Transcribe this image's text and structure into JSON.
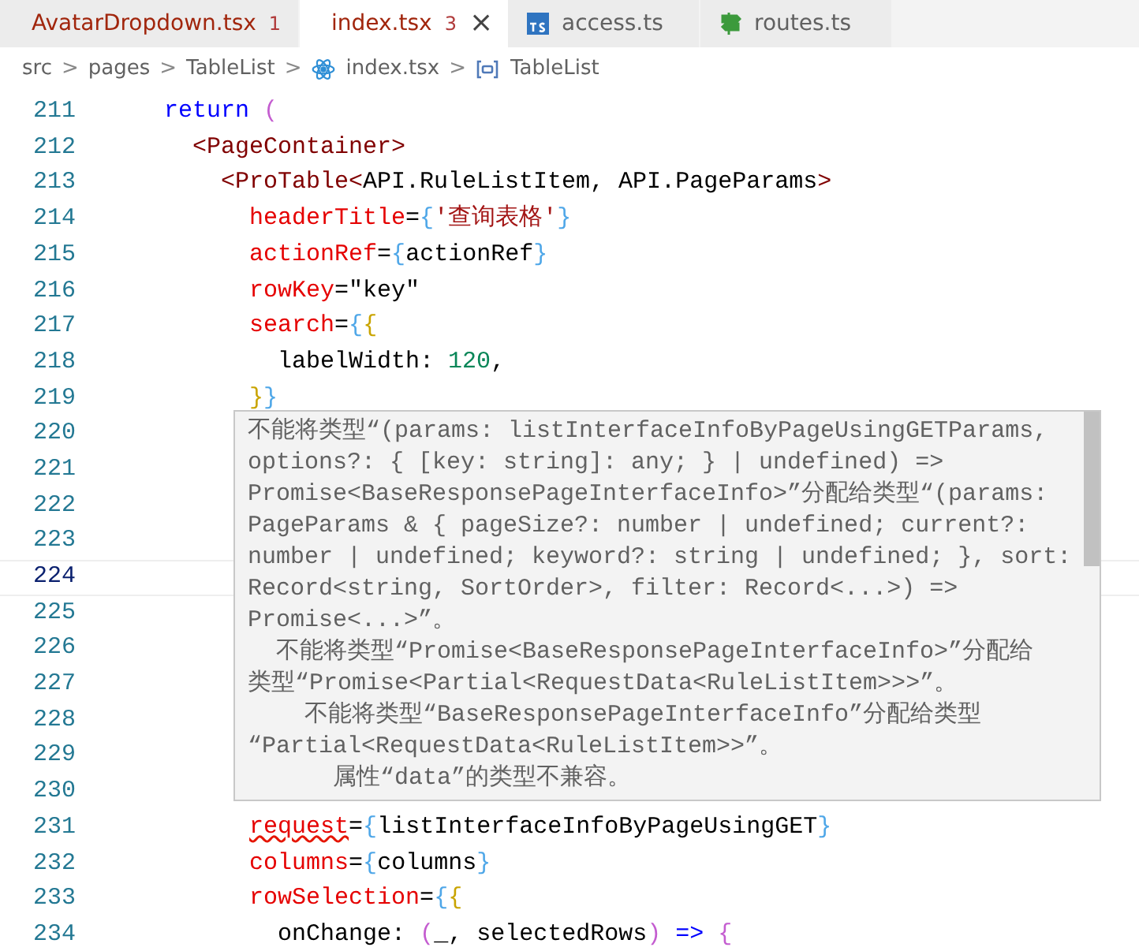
{
  "tabs": [
    {
      "label": "AvatarDropdown.tsx",
      "badge": "1",
      "kind": "react",
      "selected": false,
      "error": true
    },
    {
      "label": "index.tsx",
      "badge": "3",
      "kind": "react",
      "selected": true,
      "error": true,
      "close": "×"
    },
    {
      "label": "access.ts",
      "kind": "ts",
      "selected": false,
      "error": false
    },
    {
      "label": "routes.ts",
      "kind": "route",
      "selected": false,
      "error": false
    }
  ],
  "breadcrumb": [
    {
      "label": "src",
      "kind": "folder"
    },
    {
      "label": "pages",
      "kind": "folder"
    },
    {
      "label": "TableList",
      "kind": "folder"
    },
    {
      "label": "index.tsx",
      "kind": "react"
    },
    {
      "label": "TableList",
      "kind": "symbol"
    }
  ],
  "separator": ">",
  "editor": {
    "lines": [
      {
        "number": "211",
        "current": false,
        "tokens": [
          {
            "kind": "keyword",
            "text": "    return"
          },
          {
            "kind": "bracket3",
            "text": " ("
          }
        ]
      },
      {
        "number": "212",
        "current": false,
        "tokens": [
          {
            "kind": "tag",
            "text": "      <PageContainer>"
          }
        ]
      },
      {
        "number": "213",
        "current": false,
        "tokens": [
          {
            "kind": "tag",
            "text": "        <ProTable<"
          },
          {
            "kind": "plain",
            "text": "API.RuleListItem, API.PageParams"
          },
          {
            "kind": "tag",
            "text": ">"
          }
        ]
      },
      {
        "number": "214",
        "current": false,
        "tokens": [
          {
            "kind": "attr",
            "text": "          headerTitle"
          },
          {
            "kind": "plain",
            "text": "="
          },
          {
            "kind": "bracket1",
            "text": "{"
          },
          {
            "kind": "string",
            "text": "'查询表格'"
          },
          {
            "kind": "bracket1",
            "text": "}"
          }
        ]
      },
      {
        "number": "215",
        "current": false,
        "tokens": [
          {
            "kind": "attr",
            "text": "          actionRef"
          },
          {
            "kind": "plain",
            "text": "="
          },
          {
            "kind": "bracket1",
            "text": "{"
          },
          {
            "kind": "plain",
            "text": "actionRef"
          },
          {
            "kind": "bracket1",
            "text": "}"
          }
        ]
      },
      {
        "number": "216",
        "current": false,
        "tokens": [
          {
            "kind": "attr",
            "text": "          rowKey"
          },
          {
            "kind": "plain",
            "text": "=\"key\""
          }
        ]
      },
      {
        "number": "217",
        "current": false,
        "tokens": [
          {
            "kind": "attr",
            "text": "          search"
          },
          {
            "kind": "plain",
            "text": "="
          },
          {
            "kind": "bracket1",
            "text": "{"
          },
          {
            "kind": "bracket2",
            "text": "{"
          }
        ]
      },
      {
        "number": "218",
        "current": false,
        "tokens": [
          {
            "kind": "plain",
            "text": "            labelWidth: "
          },
          {
            "kind": "number",
            "text": "120"
          },
          {
            "kind": "plain",
            "text": ","
          }
        ]
      },
      {
        "number": "219",
        "current": false,
        "tokens": [
          {
            "kind": "bracket2",
            "text": "          }"
          },
          {
            "kind": "bracket1",
            "text": "}"
          }
        ]
      },
      {
        "number": "220",
        "current": false
      },
      {
        "number": "221",
        "current": false
      },
      {
        "number": "222",
        "current": false
      },
      {
        "number": "223",
        "current": false
      },
      {
        "number": "224",
        "current": true
      },
      {
        "number": "225",
        "current": false
      },
      {
        "number": "226",
        "current": false
      },
      {
        "number": "227",
        "current": false
      },
      {
        "number": "228",
        "current": false
      },
      {
        "number": "229",
        "current": false
      },
      {
        "number": "230",
        "current": false
      },
      {
        "number": "231",
        "current": false,
        "tokens": [
          {
            "kind": "attr",
            "text": "          request",
            "error": true
          },
          {
            "kind": "plain",
            "text": "="
          },
          {
            "kind": "bracket1",
            "text": "{"
          },
          {
            "kind": "plain",
            "text": "listInterfaceInfoByPageUsingGET"
          },
          {
            "kind": "bracket1",
            "text": "}"
          }
        ]
      },
      {
        "number": "232",
        "current": false,
        "tokens": [
          {
            "kind": "attr",
            "text": "          columns"
          },
          {
            "kind": "plain",
            "text": "="
          },
          {
            "kind": "bracket1",
            "text": "{"
          },
          {
            "kind": "plain",
            "text": "columns"
          },
          {
            "kind": "bracket1",
            "text": "}"
          }
        ]
      },
      {
        "number": "233",
        "current": false,
        "tokens": [
          {
            "kind": "attr",
            "text": "          rowSelection"
          },
          {
            "kind": "plain",
            "text": "="
          },
          {
            "kind": "bracket1",
            "text": "{"
          },
          {
            "kind": "bracket2",
            "text": "{"
          }
        ]
      },
      {
        "number": "234",
        "current": false,
        "tokens": [
          {
            "kind": "plain",
            "text": "            onChange: "
          },
          {
            "kind": "bracket3",
            "text": "("
          },
          {
            "kind": "plain",
            "text": "_, selectedRows"
          },
          {
            "kind": "bracket3",
            "text": ")"
          },
          {
            "kind": "keyword",
            "text": " =>"
          },
          {
            "kind": "bracket3",
            "text": " {"
          }
        ]
      }
    ]
  },
  "hover": {
    "lines": [
      "不能将类型“(params: listInterfaceInfoByPageUsingGETParams,",
      "options?: { [key: string]: any; } | undefined) =>",
      "Promise<BaseResponsePageInterfaceInfo>”分配给类型“(params:",
      "PageParams & { pageSize?: number | undefined; current?:",
      "number | undefined; keyword?: string | undefined; }, sort:",
      "Record<string, SortOrder>, filter: Record<...>) =>",
      "Promise<...>”。",
      "  不能将类型“Promise<BaseResponsePageInterfaceInfo>”分配给",
      "类型“Promise<Partial<RequestData<RuleListItem>>>”。",
      "    不能将类型“BaseResponsePageInterfaceInfo”分配给类型",
      "“Partial<RequestData<RuleListItem>>”。",
      "      属性“data”的类型不兼容。"
    ]
  }
}
